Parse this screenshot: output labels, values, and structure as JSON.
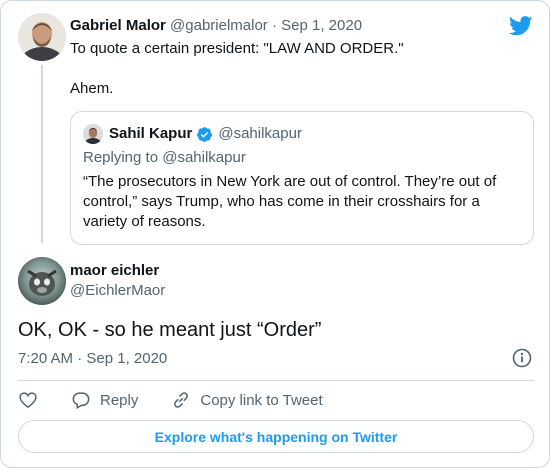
{
  "colors": {
    "brand": "#1d9bf0",
    "text_primary": "#0f1419",
    "text_secondary": "#536471",
    "border": "#cfd9de"
  },
  "parent_tweet": {
    "author_name": "Gabriel Malor",
    "handle": "@gabrielmalor",
    "separator": "·",
    "date": "Sep 1, 2020",
    "text_line1": "To quote a certain president: \"LAW AND ORDER.\"",
    "text_line2": "Ahem."
  },
  "quoted_tweet": {
    "author_name": "Sahil Kapur",
    "handle": "@sahilkapur",
    "verified": true,
    "replying_to": "Replying to @sahilkapur",
    "text": "“The prosecutors in New York are out of control. They’re out of control,” says Trump, who has come in their crosshairs for a variety of reasons."
  },
  "main_tweet": {
    "author_name": "maor eichler",
    "handle": "@EichlerMaor",
    "text": "OK, OK - so he meant just “Order”",
    "timestamp": "7:20 AM · Sep 1, 2020"
  },
  "actions": {
    "reply_label": "Reply",
    "copy_link_label": "Copy link to Tweet"
  },
  "footer": {
    "explore_label": "Explore what's happening on Twitter"
  },
  "icons": {
    "brand": "twitter-bird-icon",
    "verified": "verified-badge-icon",
    "info": "info-icon",
    "like": "heart-icon",
    "reply": "reply-bubble-icon",
    "copy": "link-icon"
  }
}
